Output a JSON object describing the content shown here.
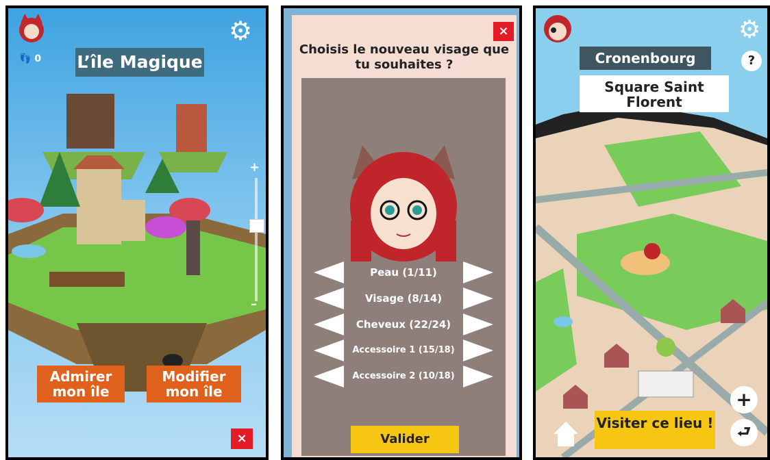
{
  "screen1": {
    "footsteps_count": "0",
    "island_title": "L’île Magique",
    "admire_button": "Admirer mon île",
    "modify_button": "Modifier mon île",
    "zoom_plus": "+",
    "zoom_minus": "–",
    "close_label": "×"
  },
  "screen2": {
    "prompt": "Choisis le nouveau visage que tu souhaites ?",
    "close_label": "×",
    "options": [
      {
        "label": "Peau (1/11)"
      },
      {
        "label": "Visage (8/14)"
      },
      {
        "label": "Cheveux (22/24)"
      },
      {
        "label": "Accessoire 1 (15/18)"
      },
      {
        "label": "Accessoire 2 (10/18)"
      }
    ],
    "validate_button": "Valider"
  },
  "screen3": {
    "district": "Cronenbourg",
    "place_name": "Square Saint Florent",
    "help_label": "?",
    "visit_button": "Visiter ce lieu !",
    "zoom_in_label": "+",
    "exit_label": "⮐"
  },
  "colors": {
    "orange": "#e0611c",
    "yellow": "#f7c613",
    "red": "#e21b24",
    "teal": "#3f6b7e"
  }
}
